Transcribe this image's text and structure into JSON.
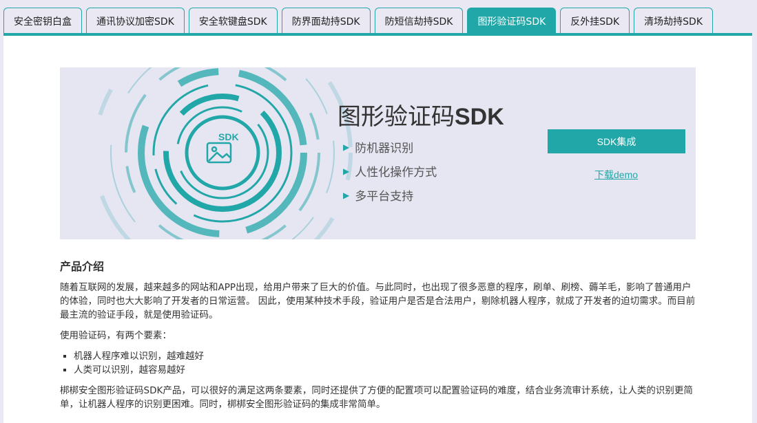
{
  "tabs": [
    {
      "label": "安全密钥白盒",
      "active": false
    },
    {
      "label": "通讯协议加密SDK",
      "active": false
    },
    {
      "label": "安全软键盘SDK",
      "active": false
    },
    {
      "label": "防界面劫持SDK",
      "active": false
    },
    {
      "label": "防短信劫持SDK",
      "active": false
    },
    {
      "label": "图形验证码SDK",
      "active": true
    },
    {
      "label": "反外挂SDK",
      "active": false
    },
    {
      "label": "清场劫持SDK",
      "active": false
    }
  ],
  "hero": {
    "title_cn": "图形验证码",
    "title_sdk": "SDK",
    "icon_label": "SDK",
    "features": [
      "防机器识别",
      "人性化操作方式",
      "多平台支持"
    ],
    "integrate_button": "SDK集成",
    "demo_link": "下载demo"
  },
  "intro": {
    "heading": "产品介绍",
    "para1": "随着互联网的发展，越来越多的网站和APP出现，给用户带来了巨大的价值。与此同时，也出现了很多恶意的程序，刷单、刷榜、薅羊毛，影响了普通用户的体验，同时也大大影响了开发者的日常运营。 因此，使用某种技术手段，验证用户是否是合法用户，剔除机器人程序，就成了开发者的迫切需求。而目前最主流的验证手段，就是使用验证码。",
    "para2": "使用验证码，有两个要素：",
    "bullets": [
      "机器人程序难以识别，越难越好",
      "人类可以识别，越容易越好"
    ],
    "para3": "梆梆安全图形验证码SDK产品，可以很好的满足这两条要素，同时还提供了方便的配置项可以配置验证码的难度，结合业务流审计系统，让人类的识别更简单，让机器人程序的识别更困难。同时，梆梆安全图形验证码的集成非常简单。"
  },
  "colors": {
    "accent": "#22a7a8",
    "background": "#e9e8f3",
    "hero_bg": "#e6e5f2"
  }
}
